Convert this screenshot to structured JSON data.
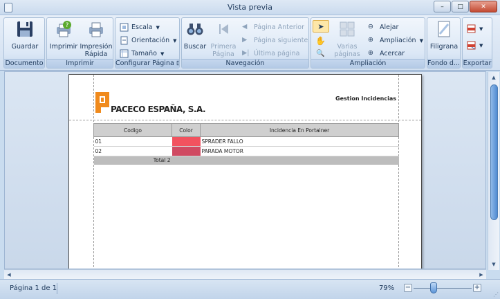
{
  "window": {
    "title": "Vista previa",
    "buttons": [
      "–",
      "□",
      "✕"
    ]
  },
  "ribbon": {
    "groups": {
      "documento": {
        "label": "Documento",
        "guardar": "Guardar"
      },
      "imprimir": {
        "label": "Imprimir",
        "imprimir": "Imprimir",
        "impresion_rapida": "Impresión Rápida"
      },
      "configurar": {
        "label": "Configurar Página",
        "escala": "Escala",
        "orientacion": "Orientación",
        "tamano": "Tamaño"
      },
      "navegacion": {
        "label": "Navegación",
        "buscar": "Buscar",
        "primera": "Primera Página",
        "anterior": "Página Anterior",
        "siguiente": "Página siguiente",
        "ultima": "Última página"
      },
      "ampliacion": {
        "label": "Ampliación",
        "varias": "Varias páginas",
        "alejar": "Alejar",
        "ampliacion": "Ampliación",
        "acercar": "Acercar"
      },
      "fondo": {
        "label": "Fondo d...",
        "filigrana": "Filigrana"
      },
      "exportar": {
        "label": "Exportar"
      }
    }
  },
  "report": {
    "company": "PACECO ESPAÑA, S.A.",
    "title": "Gestion Incidencias",
    "columns": [
      "Codigo",
      "Color",
      "Incidencia En Portainer"
    ],
    "rows": [
      {
        "codigo": "01",
        "color": "#f2525f",
        "incidencia": "SPRADER FALLO"
      },
      {
        "codigo": "02",
        "color": "#d04a62",
        "incidencia": "PARADA MOTOR"
      }
    ],
    "total_label": "Total",
    "total_value": "2"
  },
  "status": {
    "page_info": "Página 1 de 1",
    "zoom": "79%",
    "zoom_fraction": 0.79
  },
  "colors": {
    "accent": "#1e395b",
    "brand_orange": "#f08a1c"
  }
}
